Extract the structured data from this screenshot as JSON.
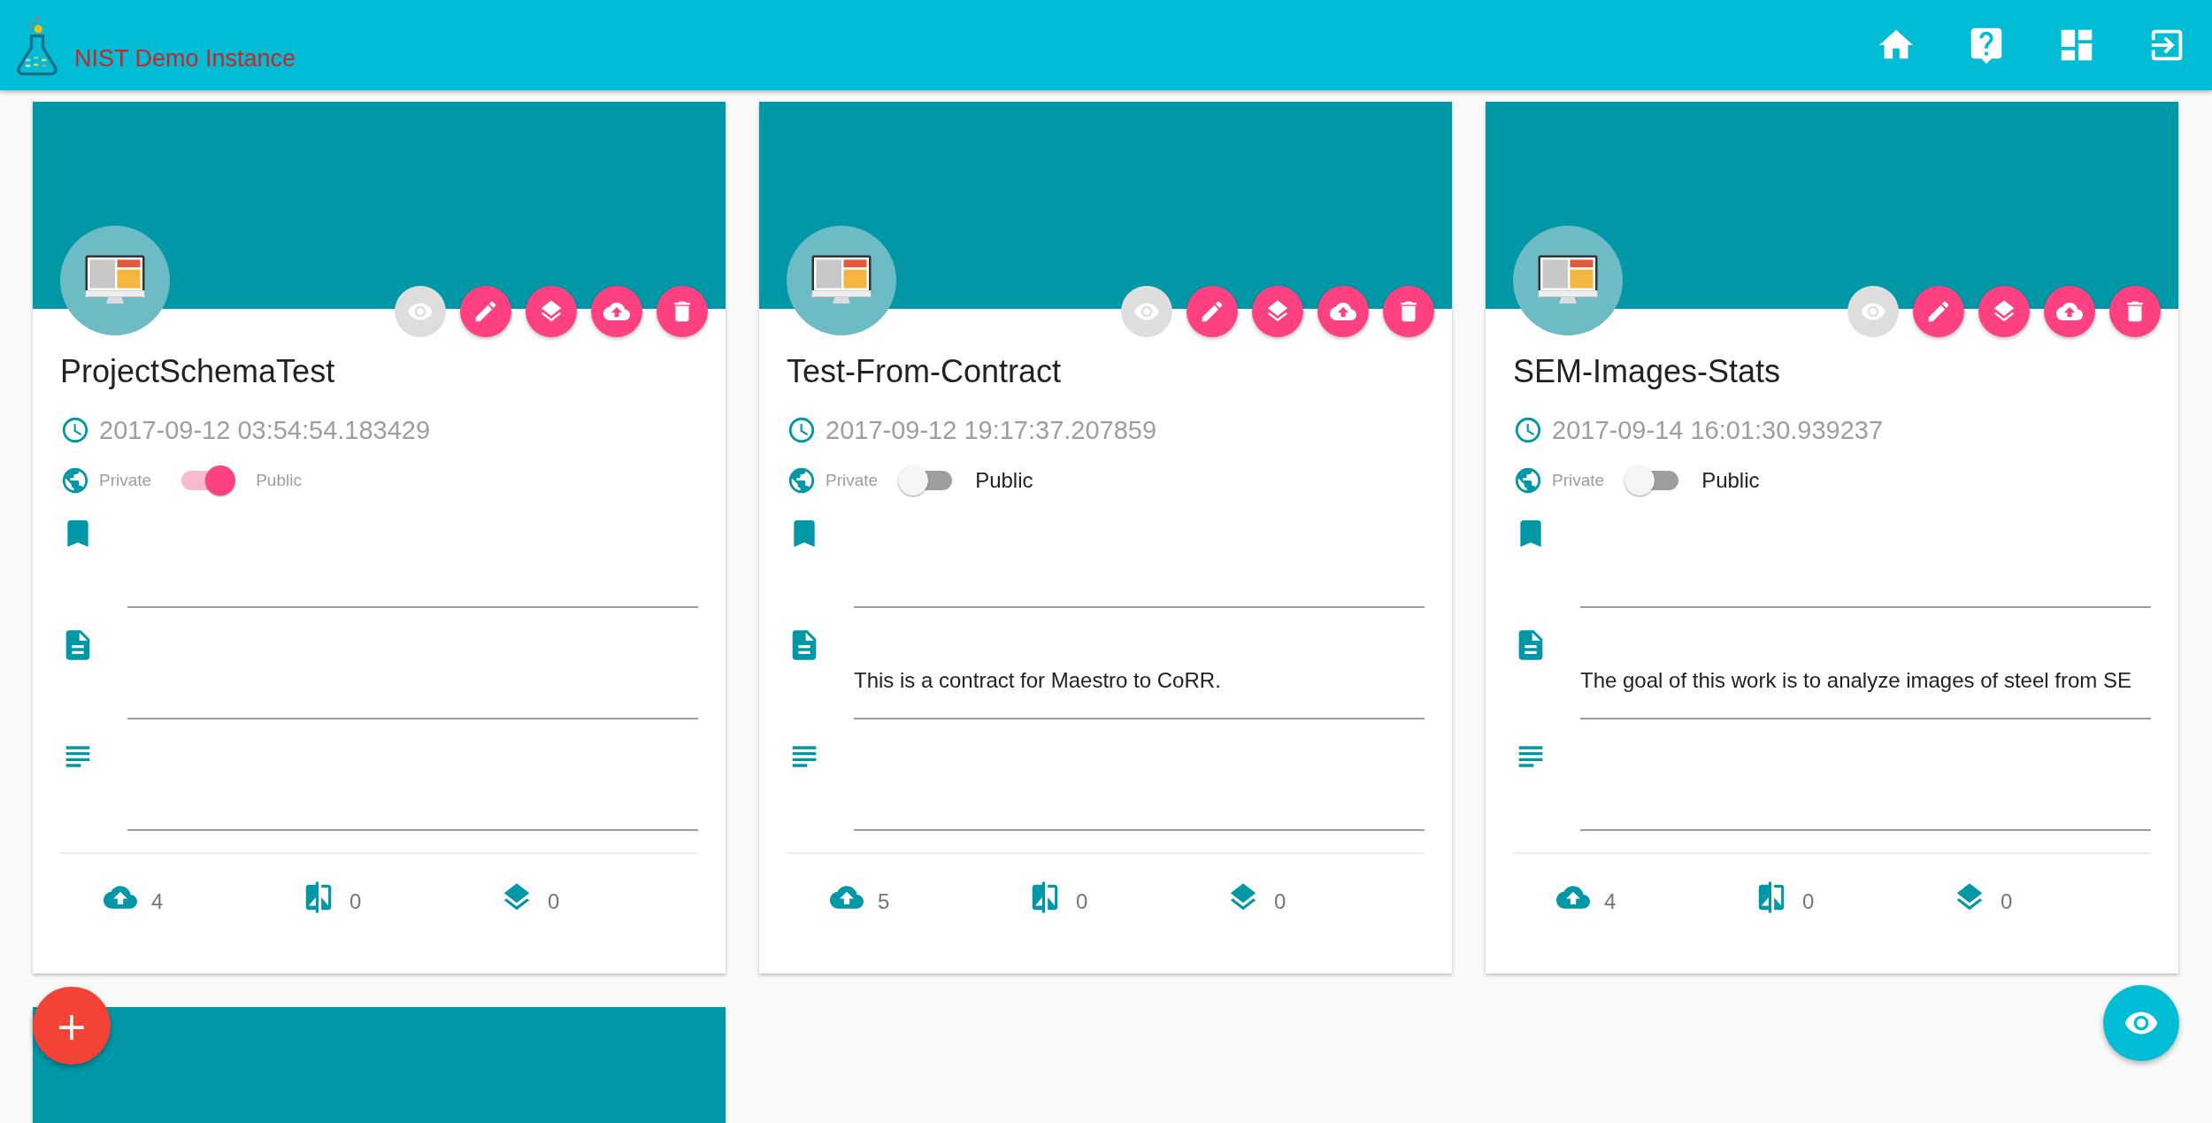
{
  "app_bar": {
    "title": "NIST Demo Instance",
    "nav": [
      {
        "kind": "home"
      },
      {
        "kind": "help"
      },
      {
        "kind": "dashboard"
      },
      {
        "kind": "logout"
      }
    ]
  },
  "projects": [
    {
      "name": "ProjectSchemaTest",
      "created": "2017-09-12 03:54:54.183429",
      "access": {
        "private_label": "Private",
        "public_label": "Public",
        "on": true
      },
      "actions": [
        {
          "kind": "view",
          "disabled": true
        },
        {
          "kind": "edit",
          "disabled": false
        },
        {
          "kind": "environments",
          "disabled": false
        },
        {
          "kind": "upload",
          "disabled": false
        },
        {
          "kind": "delete",
          "disabled": false
        }
      ],
      "fields": [
        {
          "kind": "tags"
        },
        {
          "kind": "description"
        },
        {
          "kind": "goals"
        }
      ],
      "stats": [
        {
          "kind": "records",
          "value": "4"
        },
        {
          "kind": "diffs",
          "value": "0"
        },
        {
          "kind": "environments",
          "value": "0"
        }
      ]
    },
    {
      "name": "Test-From-Contract",
      "created": "2017-09-12 19:17:37.207859",
      "access": {
        "private_label": "Private",
        "public_label": "Public",
        "on": false
      },
      "actions": [
        {
          "kind": "view",
          "disabled": true
        },
        {
          "kind": "edit",
          "disabled": false
        },
        {
          "kind": "environments",
          "disabled": false
        },
        {
          "kind": "upload",
          "disabled": false
        },
        {
          "kind": "delete",
          "disabled": false
        }
      ],
      "fields": [
        {
          "kind": "tags"
        },
        {
          "kind": "description",
          "value": "This is a contract for Maestro to CoRR."
        },
        {
          "kind": "goals"
        }
      ],
      "stats": [
        {
          "kind": "records",
          "value": "5"
        },
        {
          "kind": "diffs",
          "value": "0"
        },
        {
          "kind": "environments",
          "value": "0"
        }
      ]
    },
    {
      "name": "SEM-Images-Stats",
      "created": "2017-09-14 16:01:30.939237",
      "access": {
        "private_label": "Private",
        "public_label": "Public",
        "on": false
      },
      "actions": [
        {
          "kind": "view",
          "disabled": true
        },
        {
          "kind": "edit",
          "disabled": false
        },
        {
          "kind": "environments",
          "disabled": false
        },
        {
          "kind": "upload",
          "disabled": false
        },
        {
          "kind": "delete",
          "disabled": false
        }
      ],
      "fields": [
        {
          "kind": "tags"
        },
        {
          "kind": "description",
          "value": "The goal of this work is to analyze images of steel from SE"
        },
        {
          "kind": "goals"
        }
      ],
      "stats": [
        {
          "kind": "records",
          "value": "4"
        },
        {
          "kind": "diffs",
          "value": "0"
        },
        {
          "kind": "environments",
          "value": "0"
        }
      ]
    }
  ],
  "add_button": {
    "label": "+"
  },
  "view_button": {
    "kind": "view"
  }
}
